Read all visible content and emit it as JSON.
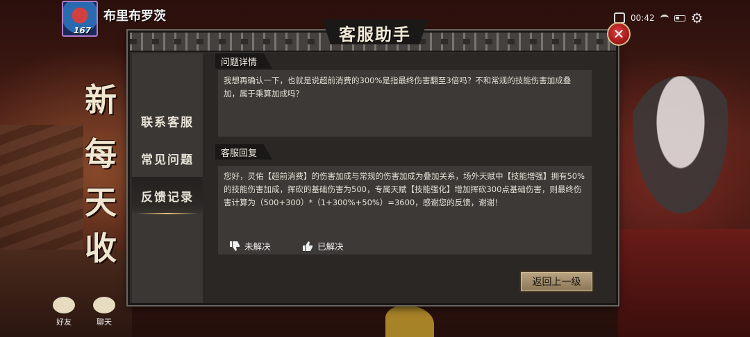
{
  "player": {
    "name": "布里布罗茨",
    "level": "167"
  },
  "status_bar": {
    "time": "00:42"
  },
  "background_chars": [
    "新",
    "每",
    "天",
    "收"
  ],
  "dialog": {
    "title": "客服助手",
    "sidebar": [
      {
        "label": "联系客服",
        "active": false
      },
      {
        "label": "常见问题",
        "active": false
      },
      {
        "label": "反馈记录",
        "active": true
      }
    ],
    "question": {
      "header": "问题详情",
      "text": "我想再确认一下，也就是说超前消费的300%是指最终伤害翻至3倍吗？不和常规的技能伤害加成叠加，属于乘算加成吗？"
    },
    "reply": {
      "header": "客服回复",
      "text": "您好，灵佑【超前消费】的伤害加成与常规的伤害加成为叠加关系，场外天赋中【技能增强】拥有50%的技能伤害加成，挥砍的基础伤害为500，专属天赋【技能强化】增加挥砍300点基础伤害，则最终伤害计算为（500+300）*（1+300%+50%）=3600，感谢您的反馈，谢谢！"
    },
    "votes": {
      "unsolved": "未解决",
      "solved": "已解决"
    },
    "back_button": "返回上一级"
  },
  "bottom_nav": {
    "friends": "好友",
    "chat": "聊天"
  },
  "colors": {
    "accent_gold": "#e8c070",
    "close_red": "#c02020",
    "button_tan": "#b9a582"
  }
}
